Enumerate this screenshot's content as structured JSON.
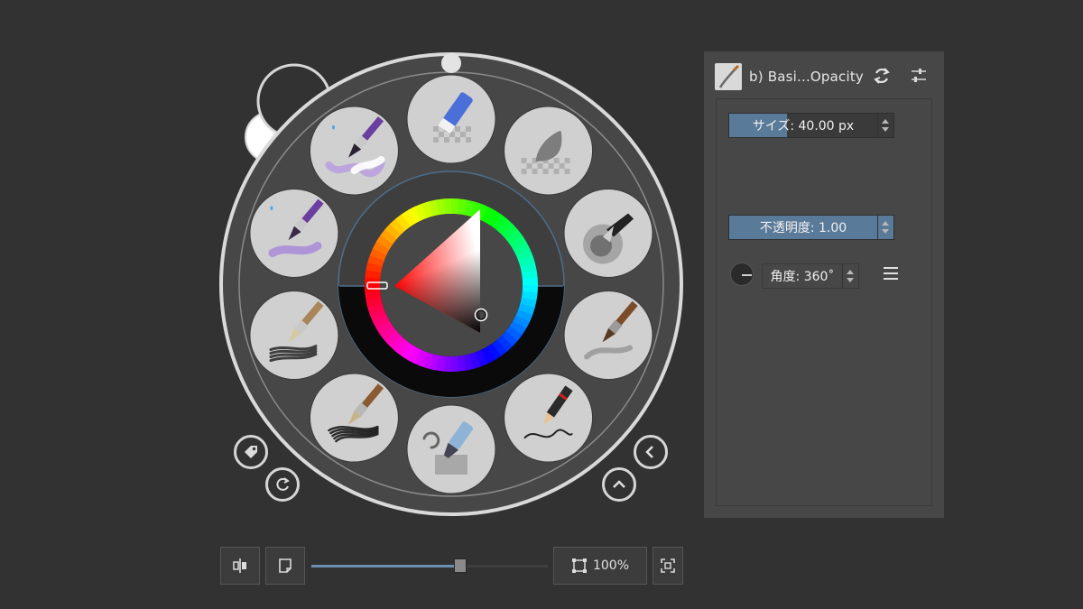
{
  "palette": {
    "brushes": [
      {
        "icon": "eraser-icon"
      },
      {
        "icon": "blender-icon"
      },
      {
        "icon": "airbrush-icon"
      },
      {
        "icon": "round-brush-icon"
      },
      {
        "icon": "pencil-icon"
      },
      {
        "icon": "marker-icon"
      },
      {
        "icon": "bristle-brush-icon"
      },
      {
        "icon": "bristle-round-brush-icon"
      },
      {
        "icon": "watercolor-brush-icon"
      },
      {
        "icon": "wet-brush-icon"
      }
    ],
    "hue": 0,
    "tag_button_icon": "tag-icon",
    "reset_button_icon": "reset-rotation-icon",
    "prev_button_icon": "chevron-left-icon",
    "up_button_icon": "chevron-up-icon"
  },
  "docker": {
    "preset_name": "b) Basi...Opacity",
    "reload_icon": "reload-icon",
    "settings_icon": "sliders-icon",
    "size": {
      "text": "サイズ: 40.00 px",
      "fraction": 0.35
    },
    "opacity": {
      "text": "不透明度: 1.00",
      "fraction": 1.0
    },
    "angle": {
      "text": "角度: 360˚"
    },
    "menu_icon": "hamburger-icon"
  },
  "toolbar": {
    "mirror_icon": "mirror-icon",
    "canvas_icon": "document-icon",
    "zoom_fraction": 0.63,
    "zoom_label": "100%",
    "fit_icon": "fit-to-view-icon",
    "fullscreen_icon": "fullscreen-icon"
  },
  "colors": {
    "accent": "#5a7a99",
    "zoom_fill": "#6a8fb0",
    "background": "#323232",
    "docker_bg": "#474747",
    "ring_outline": "#d6d6d6",
    "slot_bg": "#d0d0d0"
  }
}
